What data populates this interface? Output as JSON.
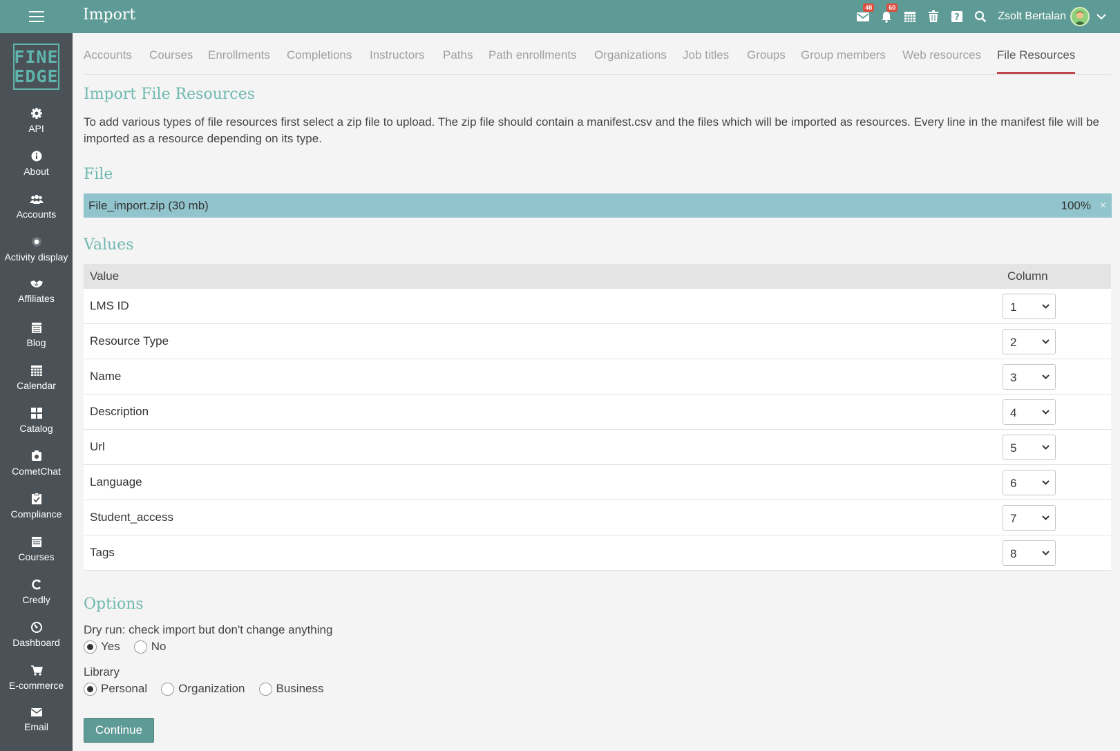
{
  "header": {
    "title": "Import",
    "messages_badge": "48",
    "notifications_badge": "60",
    "user_name": "Zsolt Bertalan",
    "icons": [
      "menu-icon",
      "mail-icon",
      "bell-icon",
      "calendar-icon",
      "trash-icon",
      "help-icon",
      "search-icon",
      "chevron-down-icon"
    ]
  },
  "logo": {
    "line1": "FINE",
    "line2": "EDGE"
  },
  "sidebar": {
    "items": [
      {
        "label": "API",
        "icon": "gear-icon"
      },
      {
        "label": "About",
        "icon": "info-icon"
      },
      {
        "label": "Accounts",
        "icon": "users-icon"
      },
      {
        "label": "Activity display",
        "icon": "dot-circle-icon"
      },
      {
        "label": "Affiliates",
        "icon": "handshake-icon"
      },
      {
        "label": "Blog",
        "icon": "blog-icon"
      },
      {
        "label": "Calendar",
        "icon": "calendar-icon"
      },
      {
        "label": "Catalog",
        "icon": "grid-icon"
      },
      {
        "label": "CometChat",
        "icon": "chat-icon"
      },
      {
        "label": "Compliance",
        "icon": "checklist-icon"
      },
      {
        "label": "Courses",
        "icon": "book-icon"
      },
      {
        "label": "Credly",
        "icon": "credly-icon"
      },
      {
        "label": "Dashboard",
        "icon": "gauge-icon"
      },
      {
        "label": "E-commerce",
        "icon": "cart-icon"
      },
      {
        "label": "Email",
        "icon": "envelope-icon"
      }
    ]
  },
  "tabs": [
    {
      "label": "Accounts"
    },
    {
      "label": "Courses"
    },
    {
      "label": "Enrollments"
    },
    {
      "label": "Completions"
    },
    {
      "label": "Instructors"
    },
    {
      "label": "Paths"
    },
    {
      "label": "Path enrollments"
    },
    {
      "label": "Organizations"
    },
    {
      "label": "Job titles"
    },
    {
      "label": "Groups"
    },
    {
      "label": "Group members"
    },
    {
      "label": "Web resources"
    },
    {
      "label": "File Resources",
      "active": true
    }
  ],
  "main": {
    "heading": "Import File Resources",
    "description": "To add various types of file resources first select a zip file to upload. The zip file should contain a manifest.csv and the files which will be imported as resources. Every line in the manifest file will be imported as a resource depending on its type.",
    "file_heading": "File",
    "file": {
      "name": "File_import.zip (30 mb)",
      "progress": "100%",
      "close": "×"
    },
    "values_heading": "Values",
    "table": {
      "headers": [
        "Value",
        "Column"
      ],
      "rows": [
        {
          "value": "LMS ID",
          "column": "1"
        },
        {
          "value": "Resource Type",
          "column": "2"
        },
        {
          "value": "Name",
          "column": "3"
        },
        {
          "value": "Description",
          "column": "4"
        },
        {
          "value": "Url",
          "column": "5"
        },
        {
          "value": "Language",
          "column": "6"
        },
        {
          "value": "Student_access",
          "column": "7"
        },
        {
          "value": "Tags",
          "column": "8"
        }
      ]
    },
    "options_heading": "Options",
    "dry_run": {
      "label": "Dry run: check import but don't change anything",
      "options": [
        "Yes",
        "No"
      ],
      "selected": "Yes"
    },
    "library": {
      "label": "Library",
      "options": [
        "Personal",
        "Organization",
        "Business"
      ],
      "selected": "Personal"
    },
    "continue_label": "Continue"
  },
  "colors": {
    "topbar": "#5f9b96",
    "sidebar": "#4a5257",
    "accent_heading": "#6fb9b0",
    "active_tab_underline": "#c0454a",
    "file_bar": "#91c4cc",
    "badge": "#e04b3c"
  }
}
